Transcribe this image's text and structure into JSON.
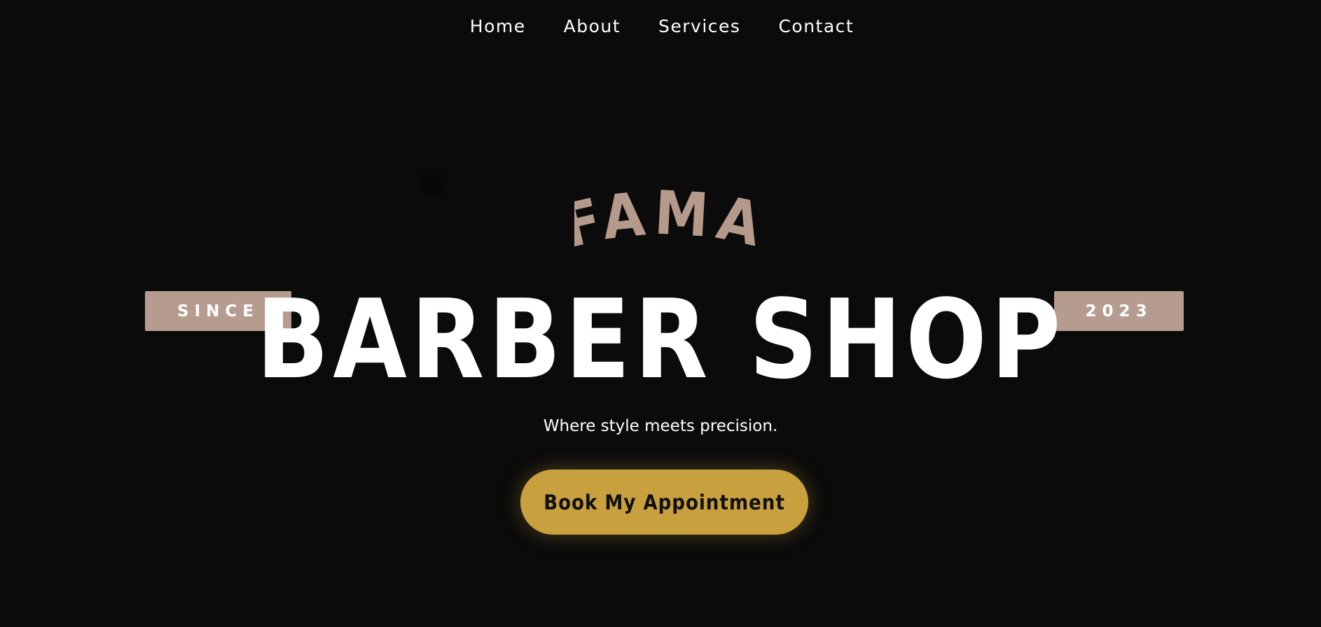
{
  "nav": {
    "items": [
      {
        "label": "Home"
      },
      {
        "label": "About"
      },
      {
        "label": "Services"
      },
      {
        "label": "Contact"
      }
    ]
  },
  "hero": {
    "brand": "FAMA",
    "since_label": "SINCE",
    "year_label": "2023",
    "title": "BARBER SHOP",
    "tagline": "Where style meets precision.",
    "cta_label": "Book My Appointment"
  },
  "colors": {
    "background": "#0b0b0b",
    "brand_accent": "#b59a8b",
    "badge": "#b59c8e",
    "cta": "#c9a03e",
    "text": "#ffffff"
  }
}
